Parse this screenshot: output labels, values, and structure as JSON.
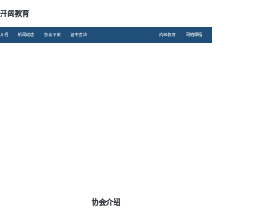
{
  "header": {
    "logo_text": "开阔教育"
  },
  "nav": {
    "left_items": [
      "介绍",
      "新闻动态",
      "协会专家",
      "证书查询"
    ],
    "right_items": [
      "向峰教育",
      "网络课程"
    ]
  },
  "main": {
    "section_title": "协会介绍"
  },
  "colors": {
    "navbar_background": "#1f4f78",
    "navbar_text": "#ffffff",
    "page_background": "#ffffff",
    "heading_text": "#2b2f36"
  }
}
